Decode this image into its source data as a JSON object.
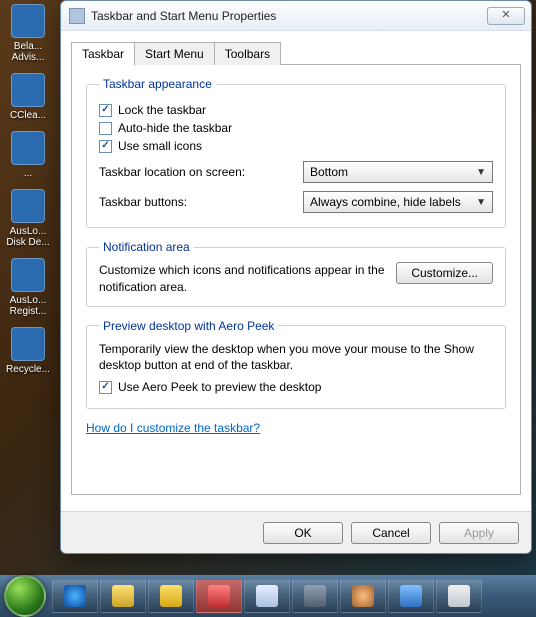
{
  "window": {
    "title": "Taskbar and Start Menu Properties"
  },
  "tabs": {
    "taskbar": "Taskbar",
    "startmenu": "Start Menu",
    "toolbars": "Toolbars"
  },
  "appearance": {
    "legend": "Taskbar appearance",
    "lock": {
      "label": "Lock the taskbar",
      "checked": true
    },
    "autohide": {
      "label": "Auto-hide the taskbar",
      "checked": false
    },
    "smallicons": {
      "label": "Use small icons",
      "checked": true
    },
    "location_label": "Taskbar location on screen:",
    "location_value": "Bottom",
    "buttons_label": "Taskbar buttons:",
    "buttons_value": "Always combine, hide labels"
  },
  "notification": {
    "legend": "Notification area",
    "text": "Customize which icons and notifications appear in the notification area.",
    "button": "Customize..."
  },
  "aero": {
    "legend": "Preview desktop with Aero Peek",
    "text": "Temporarily view the desktop when you move your mouse to the Show desktop button at end of the taskbar.",
    "checkbox": {
      "label": "Use Aero Peek to preview the desktop",
      "checked": true
    }
  },
  "helplink": "How do I customize the taskbar?",
  "buttons": {
    "ok": "OK",
    "cancel": "Cancel",
    "apply": "Apply"
  },
  "desktop_icons": [
    "Bela... Advis...",
    "CClea...",
    "...",
    "AusLo... Disk De...",
    "AusLo... Regist...",
    "Recycle..."
  ]
}
